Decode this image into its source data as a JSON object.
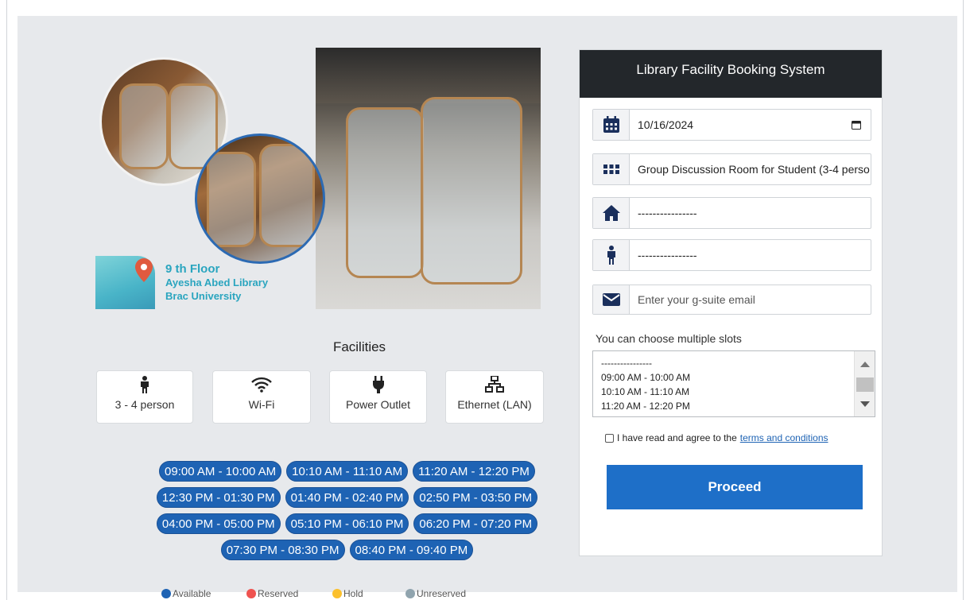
{
  "promo": {
    "floor": "9 th Floor",
    "library": "Ayesha Abed Library",
    "university": "Brac University"
  },
  "facilities": {
    "title": "Facilities",
    "items": [
      {
        "icon": "person-icon",
        "label": "3 - 4 person"
      },
      {
        "icon": "wifi-icon",
        "label": "Wi-Fi"
      },
      {
        "icon": "power-plug-icon",
        "label": "Power Outlet"
      },
      {
        "icon": "network-icon",
        "label": "Ethernet (LAN)"
      }
    ]
  },
  "slots": {
    "rows": [
      [
        "09:00 AM - 10:00 AM",
        "10:10 AM - 11:10 AM",
        "11:20 AM - 12:20 PM"
      ],
      [
        "12:30 PM - 01:30 PM",
        "01:40 PM - 02:40 PM",
        "02:50 PM - 03:50 PM"
      ],
      [
        "04:00 PM - 05:00 PM",
        "05:10 PM - 06:10 PM",
        "06:20 PM - 07:20 PM"
      ],
      [
        "07:30 PM - 08:30 PM",
        "08:40 PM - 09:40 PM"
      ]
    ]
  },
  "legend": [
    {
      "label": "Available",
      "color": "#1e63b4"
    },
    {
      "label": "Reserved",
      "color": "#ef5350"
    },
    {
      "label": "Hold",
      "color": "#fbc02d"
    },
    {
      "label": "Unreserved",
      "color": "#90a4ae"
    }
  ],
  "booking": {
    "title": "Library Facility Booking System",
    "date": "10/16/2024",
    "room_type": "Group Discussion Room for Student (3-4 perso",
    "room": "----------------",
    "person": "----------------",
    "email_placeholder": "Enter your g-suite email",
    "multi_label": "You can choose multiple slots",
    "slot_options": [
      "----------------",
      "09:00 AM - 10:00 AM",
      "10:10 AM - 11:10 AM",
      "11:20 AM - 12:20 PM"
    ],
    "terms_prefix": "I have read and agree to the",
    "terms_link": "terms and conditions",
    "proceed": "Proceed"
  },
  "colors": {
    "primary": "#1e63b4",
    "header_dark": "#23272b",
    "icon_navy": "#1a2f5c"
  }
}
